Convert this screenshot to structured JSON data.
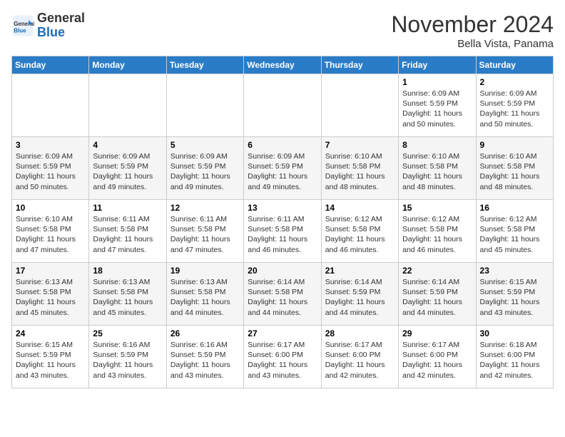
{
  "logo": {
    "general": "General",
    "blue": "Blue"
  },
  "header": {
    "month_title": "November 2024",
    "location": "Bella Vista, Panama"
  },
  "weekdays": [
    "Sunday",
    "Monday",
    "Tuesday",
    "Wednesday",
    "Thursday",
    "Friday",
    "Saturday"
  ],
  "weeks": [
    [
      {
        "day": "",
        "info": ""
      },
      {
        "day": "",
        "info": ""
      },
      {
        "day": "",
        "info": ""
      },
      {
        "day": "",
        "info": ""
      },
      {
        "day": "",
        "info": ""
      },
      {
        "day": "1",
        "info": "Sunrise: 6:09 AM\nSunset: 5:59 PM\nDaylight: 11 hours\nand 50 minutes."
      },
      {
        "day": "2",
        "info": "Sunrise: 6:09 AM\nSunset: 5:59 PM\nDaylight: 11 hours\nand 50 minutes."
      }
    ],
    [
      {
        "day": "3",
        "info": "Sunrise: 6:09 AM\nSunset: 5:59 PM\nDaylight: 11 hours\nand 50 minutes."
      },
      {
        "day": "4",
        "info": "Sunrise: 6:09 AM\nSunset: 5:59 PM\nDaylight: 11 hours\nand 49 minutes."
      },
      {
        "day": "5",
        "info": "Sunrise: 6:09 AM\nSunset: 5:59 PM\nDaylight: 11 hours\nand 49 minutes."
      },
      {
        "day": "6",
        "info": "Sunrise: 6:09 AM\nSunset: 5:59 PM\nDaylight: 11 hours\nand 49 minutes."
      },
      {
        "day": "7",
        "info": "Sunrise: 6:10 AM\nSunset: 5:58 PM\nDaylight: 11 hours\nand 48 minutes."
      },
      {
        "day": "8",
        "info": "Sunrise: 6:10 AM\nSunset: 5:58 PM\nDaylight: 11 hours\nand 48 minutes."
      },
      {
        "day": "9",
        "info": "Sunrise: 6:10 AM\nSunset: 5:58 PM\nDaylight: 11 hours\nand 48 minutes."
      }
    ],
    [
      {
        "day": "10",
        "info": "Sunrise: 6:10 AM\nSunset: 5:58 PM\nDaylight: 11 hours\nand 47 minutes."
      },
      {
        "day": "11",
        "info": "Sunrise: 6:11 AM\nSunset: 5:58 PM\nDaylight: 11 hours\nand 47 minutes."
      },
      {
        "day": "12",
        "info": "Sunrise: 6:11 AM\nSunset: 5:58 PM\nDaylight: 11 hours\nand 47 minutes."
      },
      {
        "day": "13",
        "info": "Sunrise: 6:11 AM\nSunset: 5:58 PM\nDaylight: 11 hours\nand 46 minutes."
      },
      {
        "day": "14",
        "info": "Sunrise: 6:12 AM\nSunset: 5:58 PM\nDaylight: 11 hours\nand 46 minutes."
      },
      {
        "day": "15",
        "info": "Sunrise: 6:12 AM\nSunset: 5:58 PM\nDaylight: 11 hours\nand 46 minutes."
      },
      {
        "day": "16",
        "info": "Sunrise: 6:12 AM\nSunset: 5:58 PM\nDaylight: 11 hours\nand 45 minutes."
      }
    ],
    [
      {
        "day": "17",
        "info": "Sunrise: 6:13 AM\nSunset: 5:58 PM\nDaylight: 11 hours\nand 45 minutes."
      },
      {
        "day": "18",
        "info": "Sunrise: 6:13 AM\nSunset: 5:58 PM\nDaylight: 11 hours\nand 45 minutes."
      },
      {
        "day": "19",
        "info": "Sunrise: 6:13 AM\nSunset: 5:58 PM\nDaylight: 11 hours\nand 44 minutes."
      },
      {
        "day": "20",
        "info": "Sunrise: 6:14 AM\nSunset: 5:58 PM\nDaylight: 11 hours\nand 44 minutes."
      },
      {
        "day": "21",
        "info": "Sunrise: 6:14 AM\nSunset: 5:59 PM\nDaylight: 11 hours\nand 44 minutes."
      },
      {
        "day": "22",
        "info": "Sunrise: 6:14 AM\nSunset: 5:59 PM\nDaylight: 11 hours\nand 44 minutes."
      },
      {
        "day": "23",
        "info": "Sunrise: 6:15 AM\nSunset: 5:59 PM\nDaylight: 11 hours\nand 43 minutes."
      }
    ],
    [
      {
        "day": "24",
        "info": "Sunrise: 6:15 AM\nSunset: 5:59 PM\nDaylight: 11 hours\nand 43 minutes."
      },
      {
        "day": "25",
        "info": "Sunrise: 6:16 AM\nSunset: 5:59 PM\nDaylight: 11 hours\nand 43 minutes."
      },
      {
        "day": "26",
        "info": "Sunrise: 6:16 AM\nSunset: 5:59 PM\nDaylight: 11 hours\nand 43 minutes."
      },
      {
        "day": "27",
        "info": "Sunrise: 6:17 AM\nSunset: 6:00 PM\nDaylight: 11 hours\nand 43 minutes."
      },
      {
        "day": "28",
        "info": "Sunrise: 6:17 AM\nSunset: 6:00 PM\nDaylight: 11 hours\nand 42 minutes."
      },
      {
        "day": "29",
        "info": "Sunrise: 6:17 AM\nSunset: 6:00 PM\nDaylight: 11 hours\nand 42 minutes."
      },
      {
        "day": "30",
        "info": "Sunrise: 6:18 AM\nSunset: 6:00 PM\nDaylight: 11 hours\nand 42 minutes."
      }
    ]
  ]
}
